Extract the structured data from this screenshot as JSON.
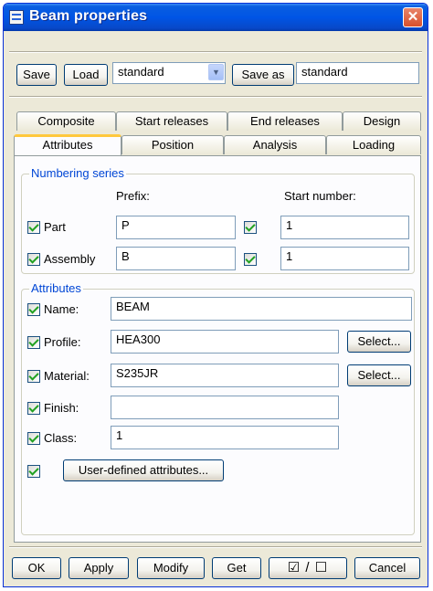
{
  "window": {
    "title": "Beam properties",
    "close_symbol": "✕"
  },
  "toolbar": {
    "save_label": "Save",
    "load_label": "Load",
    "load_combo_value": "standard",
    "save_as_label": "Save as",
    "save_as_value": "standard"
  },
  "tabs": {
    "row_back": [
      "Composite",
      "Start releases",
      "End releases",
      "Design"
    ],
    "row_front": [
      "Attributes",
      "Position",
      "Analysis",
      "Loading"
    ],
    "active": "Attributes"
  },
  "numbering": {
    "group_title": "Numbering series",
    "prefix_header": "Prefix:",
    "start_header": "Start number:",
    "rows": [
      {
        "label": "Part",
        "checked": true,
        "prefix": "P",
        "start_checked": true,
        "start": "1"
      },
      {
        "label": "Assembly",
        "checked": true,
        "prefix": "B",
        "start_checked": true,
        "start": "1"
      }
    ]
  },
  "attributes": {
    "group_title": "Attributes",
    "name": {
      "label": "Name:",
      "value": "BEAM"
    },
    "profile": {
      "label": "Profile:",
      "value": "HEA300",
      "button": "Select..."
    },
    "material": {
      "label": "Material:",
      "value": "S235JR",
      "button": "Select..."
    },
    "finish": {
      "label": "Finish:",
      "value": ""
    },
    "class": {
      "label": "Class:",
      "value": "1"
    },
    "udа_button": "User-defined attributes..."
  },
  "footer": {
    "ok": "OK",
    "apply": "Apply",
    "modify": "Modify",
    "get": "Get",
    "toggle": "☑ / ☐",
    "cancel": "Cancel"
  },
  "colors": {
    "title_bar": "#0055e5",
    "dialog_bg": "#ece9d8",
    "group_title": "#0046d5",
    "check_mark": "#21a121",
    "active_tab_highlight": "#ffc83c"
  }
}
